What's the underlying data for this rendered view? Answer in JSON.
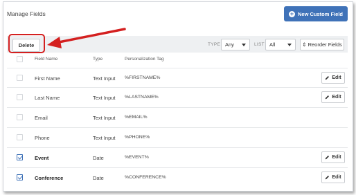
{
  "header": {
    "title": "Manage Fields",
    "new_button_label": "New Custom Field",
    "new_button_icon": "plus-circle-icon"
  },
  "toolbar": {
    "delete_label": "Delete",
    "type_label": "TYPE",
    "type_value": "Any",
    "list_label": "LIST",
    "list_value": "All",
    "reorder_label": "⇕ Reorder Fields"
  },
  "table": {
    "columns": [
      "Field Name",
      "Type",
      "Personalization Tag"
    ],
    "rows": [
      {
        "name": "First Name",
        "type": "Text Input",
        "tag": "%FIRSTNAME%",
        "checked": false,
        "editable": true,
        "bold": false
      },
      {
        "name": "Last Name",
        "type": "Text Input",
        "tag": "%LASTNAME%",
        "checked": false,
        "editable": true,
        "bold": false
      },
      {
        "name": "Email",
        "type": "Text Input",
        "tag": "%EMAIL%",
        "checked": false,
        "editable": false,
        "bold": false
      },
      {
        "name": "Phone",
        "type": "Text Input",
        "tag": "%PHONE%",
        "checked": false,
        "editable": false,
        "bold": false
      },
      {
        "name": "Event",
        "type": "Date",
        "tag": "%EVENT%",
        "checked": true,
        "editable": true,
        "bold": true
      },
      {
        "name": "Conference",
        "type": "Date",
        "tag": "%CONFERENCE%",
        "checked": true,
        "editable": true,
        "bold": true
      }
    ],
    "edit_label": "Edit"
  },
  "colors": {
    "accent": "#3f72b8",
    "annotation": "#d42020"
  }
}
